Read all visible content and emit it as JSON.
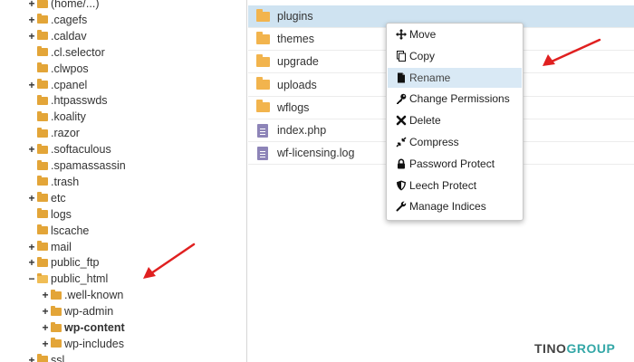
{
  "tree": {
    "items": [
      {
        "label": "(home/...)",
        "toggle": "+",
        "bold": false
      },
      {
        "label": ".cagefs",
        "toggle": "+",
        "bold": false
      },
      {
        "label": ".caldav",
        "toggle": "+",
        "bold": false
      },
      {
        "label": ".cl.selector",
        "toggle": "",
        "bold": false
      },
      {
        "label": ".clwpos",
        "toggle": "",
        "bold": false
      },
      {
        "label": ".cpanel",
        "toggle": "+",
        "bold": false
      },
      {
        "label": ".htpasswds",
        "toggle": "",
        "bold": false
      },
      {
        "label": ".koality",
        "toggle": "",
        "bold": false
      },
      {
        "label": ".razor",
        "toggle": "",
        "bold": false
      },
      {
        "label": ".softaculous",
        "toggle": "+",
        "bold": false
      },
      {
        "label": ".spamassassin",
        "toggle": "",
        "bold": false
      },
      {
        "label": ".trash",
        "toggle": "",
        "bold": false
      },
      {
        "label": "etc",
        "toggle": "+",
        "bold": false
      },
      {
        "label": "logs",
        "toggle": "",
        "bold": false
      },
      {
        "label": "lscache",
        "toggle": "",
        "bold": false
      },
      {
        "label": "mail",
        "toggle": "+",
        "bold": false
      },
      {
        "label": "public_ftp",
        "toggle": "+",
        "bold": false
      },
      {
        "label": "public_html",
        "toggle": "−",
        "bold": false
      },
      {
        "label": ".well-known",
        "toggle": "+",
        "bold": false
      },
      {
        "label": "wp-admin",
        "toggle": "+",
        "bold": false
      },
      {
        "label": "wp-content",
        "toggle": "+",
        "bold": true
      },
      {
        "label": "wp-includes",
        "toggle": "+",
        "bold": false
      },
      {
        "label": "ssl",
        "toggle": "+",
        "bold": false
      }
    ]
  },
  "files": [
    {
      "name": "plugins",
      "type": "folder",
      "selected": true
    },
    {
      "name": "themes",
      "type": "folder",
      "selected": false
    },
    {
      "name": "upgrade",
      "type": "folder",
      "selected": false
    },
    {
      "name": "uploads",
      "type": "folder",
      "selected": false
    },
    {
      "name": "wflogs",
      "type": "folder",
      "selected": false
    },
    {
      "name": "index.php",
      "type": "file",
      "selected": false
    },
    {
      "name": "wf-licensing.log",
      "type": "file",
      "selected": false
    }
  ],
  "context_menu": {
    "items": [
      {
        "label": "Move",
        "icon": "move-icon",
        "highlighted": false
      },
      {
        "label": "Copy",
        "icon": "copy-icon",
        "highlighted": false
      },
      {
        "label": "Rename",
        "icon": "rename-icon",
        "highlighted": true
      },
      {
        "label": "Change Permissions",
        "icon": "key-icon",
        "highlighted": false
      },
      {
        "label": "Delete",
        "icon": "delete-icon",
        "highlighted": false
      },
      {
        "label": "Compress",
        "icon": "compress-icon",
        "highlighted": false
      },
      {
        "label": "Password Protect",
        "icon": "lock-icon",
        "highlighted": false
      },
      {
        "label": "Leech Protect",
        "icon": "shield-icon",
        "highlighted": false
      },
      {
        "label": "Manage Indices",
        "icon": "wrench-icon",
        "highlighted": false
      }
    ]
  },
  "logo": {
    "part1": "TINO",
    "part2": "GROUP"
  },
  "colors": {
    "arrow": "#e02020",
    "folder": "#f2b44d",
    "selected_row": "#cfe3f1",
    "menu_highlight": "#d9e9f5",
    "logo_accent": "#33a7a7"
  }
}
